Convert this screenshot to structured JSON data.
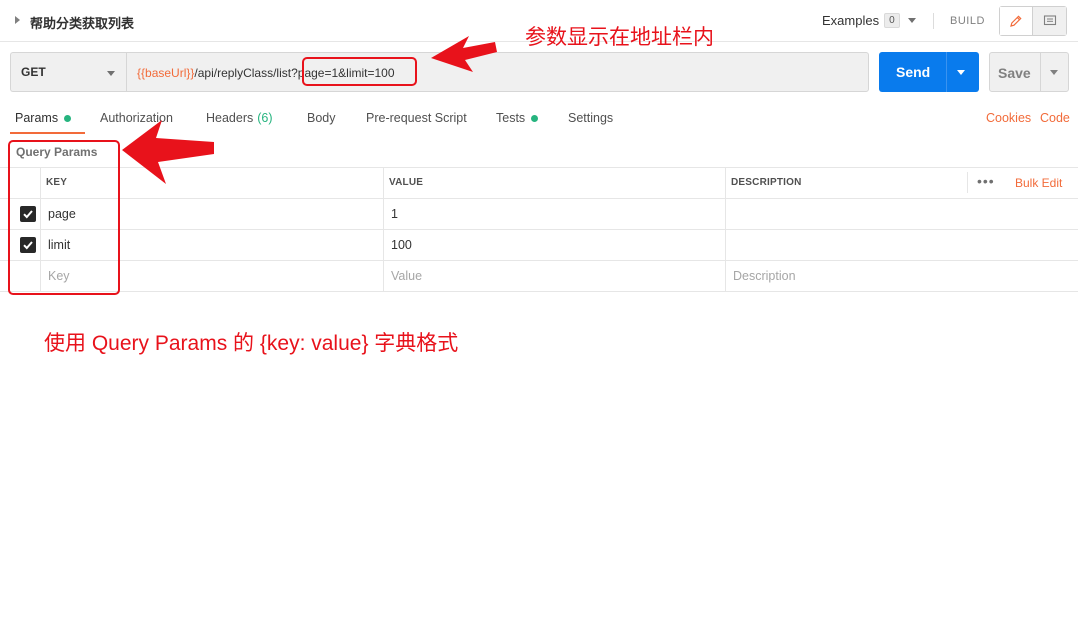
{
  "header": {
    "request_name": "帮助分类获取列表",
    "examples_label": "Examples",
    "examples_count": "0",
    "build_label": "BUILD"
  },
  "request": {
    "method": "GET",
    "url_variable": "{{baseUrl}}",
    "url_path": "/api/replyClass/list?",
    "url_query": "page=1&limit=100",
    "send_label": "Send",
    "save_label": "Save"
  },
  "tabs": [
    {
      "label": "Params",
      "indicator": "dot",
      "active": true
    },
    {
      "label": "Authorization"
    },
    {
      "label": "Headers",
      "count": "(6)"
    },
    {
      "label": "Body"
    },
    {
      "label": "Pre-request Script"
    },
    {
      "label": "Tests",
      "indicator": "dot"
    },
    {
      "label": "Settings"
    }
  ],
  "right_links": {
    "cookies": "Cookies",
    "code": "Code"
  },
  "params": {
    "title": "Query Params",
    "columns": {
      "key": "KEY",
      "value": "VALUE",
      "description": "DESCRIPTION"
    },
    "bulk_edit": "Bulk Edit",
    "rows": [
      {
        "key": "page",
        "value": "1",
        "description": "",
        "checked": true
      },
      {
        "key": "limit",
        "value": "100",
        "description": "",
        "checked": true
      }
    ],
    "placeholders": {
      "key": "Key",
      "value": "Value",
      "description": "Description"
    }
  },
  "annotations": {
    "url_note": "参数显示在地址栏内",
    "params_note": "使用 Query Params 的 {key: value} 字典格式"
  },
  "colors": {
    "accent": "#f26b3a",
    "send": "#097bed",
    "indicator": "#26b47f",
    "annotation": "#e8121b"
  }
}
